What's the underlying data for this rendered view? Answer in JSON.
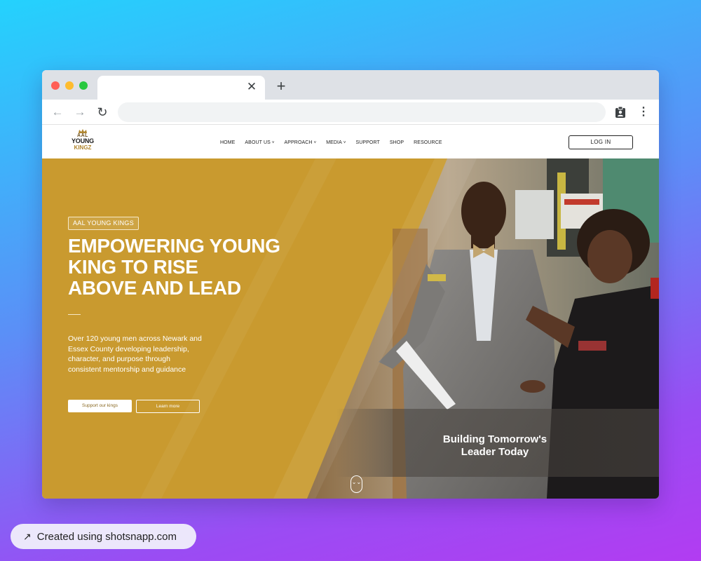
{
  "browser": {
    "tab_close_glyph": "✕",
    "new_tab_glyph": "+",
    "back_glyph": "←",
    "forward_glyph": "→",
    "reload_glyph": "↻",
    "menu_glyph": "⋮",
    "address_value": "",
    "icons": [
      "close-icon",
      "plus-icon",
      "back-arrow-icon",
      "forward-arrow-icon",
      "reload-icon",
      "clipboard-icon",
      "kebab-menu-icon"
    ]
  },
  "site": {
    "logo": {
      "line1": "AAL",
      "line2": "YOUNG",
      "line3": "KINGZ"
    },
    "nav": [
      {
        "label": "HOME",
        "dropdown": false
      },
      {
        "label": "ABOUT US",
        "dropdown": true
      },
      {
        "label": "APPROACH",
        "dropdown": true
      },
      {
        "label": "MEDIA",
        "dropdown": true
      },
      {
        "label": "SUPPORT",
        "dropdown": false
      },
      {
        "label": "SHOP",
        "dropdown": false
      },
      {
        "label": "RESOURCE",
        "dropdown": false
      }
    ],
    "chevron_glyph": "˅",
    "login_label": "LOG IN"
  },
  "hero": {
    "tag": "AAL YOUNG KINGS",
    "headline": [
      "EMPOWERING YOUNG",
      "KING TO RISE",
      "ABOVE AND LEAD"
    ],
    "description": "Over 120 young men across Newark and Essex County developing leadership, character, and purpose through consistent mentorship and guidance",
    "support_button": "Support our kings",
    "learn_button": "Learn more",
    "tagline": [
      "Building Tomorrow's",
      "Leader Today"
    ],
    "scroll_glyph": "⌄⌄"
  },
  "colors": {
    "hero_gold": "#c99a2f",
    "background_gradient_start": "#24d2fd",
    "background_gradient_end": "#b23cf2"
  },
  "credit": {
    "arrow_glyph": "↗",
    "label": "Created using shotsnapp.com"
  }
}
